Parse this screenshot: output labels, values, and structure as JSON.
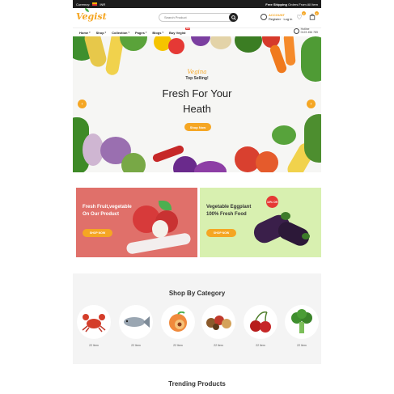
{
  "topbar": {
    "currency_label": "Currency:",
    "currency_value": "INR",
    "shipping_bold": "Free Shipping",
    "shipping_rest": "Orders From All Item"
  },
  "header": {
    "logo": "Vegist",
    "search_placeholder": "Search Product",
    "account_title": "ACCOUNT",
    "account_sub": "Register · Log in",
    "wishlist_count": "0",
    "cart_count": "0"
  },
  "nav": {
    "items": [
      "Home",
      "Shop",
      "Collection",
      "Pages",
      "Blogs",
      "Buy Vegist"
    ],
    "hot_label": "Hot",
    "help_title": "Hotline",
    "help_phone": "0123 456 789"
  },
  "hero": {
    "script": "Vegina",
    "kicker": "Top Selling!",
    "title_line1": "Fresh For Your",
    "title_line2": "Heath",
    "button": "Shop Now"
  },
  "promos": [
    {
      "line1": "Fresh Fruit,vegetable",
      "line2": "On Our Product",
      "button": "SHOP NOW"
    },
    {
      "line1": "Vegetable Eggplant",
      "line2": "100% Fresh Food",
      "button": "SHOP NOW",
      "offer": "10% Off"
    }
  ],
  "categories": {
    "title": "Shop By Category",
    "items": [
      {
        "icon": "crab-icon",
        "count": "22 Item"
      },
      {
        "icon": "fish-icon",
        "count": "22 Item"
      },
      {
        "icon": "peach-icon",
        "count": "22 Item"
      },
      {
        "icon": "spices-icon",
        "count": "22 Item"
      },
      {
        "icon": "cherry-icon",
        "count": "22 Item"
      },
      {
        "icon": "broccoli-icon",
        "count": "22 Item"
      }
    ]
  },
  "trending_title": "Trending Products",
  "colors": {
    "accent": "#f5a623",
    "promo_red": "#e0706a",
    "promo_green": "#d8f0b0",
    "topbar": "#1d1d1d"
  }
}
